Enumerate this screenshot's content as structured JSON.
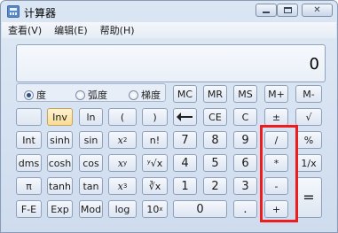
{
  "window": {
    "title": "计算器",
    "close_glyph": "✕"
  },
  "menu": [
    "查看(V)",
    "编辑(E)",
    "帮助(H)"
  ],
  "display": {
    "value": "0"
  },
  "angle_modes": [
    {
      "label": "度",
      "checked": true
    },
    {
      "label": "弧度",
      "checked": false
    },
    {
      "label": "梯度",
      "checked": false
    }
  ],
  "keys": {
    "mc": "MC",
    "mr": "MR",
    "ms": "MS",
    "mplus": "M+",
    "mminus": "M-",
    "inv": "Inv",
    "ln": "ln",
    "lparen": "(",
    "rparen": ")",
    "ce": "CE",
    "c": "C",
    "plusminus": "±",
    "sqrt": "√",
    "int": "Int",
    "sinh": "sinh",
    "sin": "sin",
    "x2_base": "x",
    "x2_exp": "2",
    "factorial": "n!",
    "seven": "7",
    "eight": "8",
    "nine": "9",
    "divide": "/",
    "percent": "%",
    "dms": "dms",
    "cosh": "cosh",
    "cos": "cos",
    "xy_base": "x",
    "xy_exp": "y",
    "yroot": "ʸ√x",
    "four": "4",
    "five": "5",
    "six": "6",
    "multiply": "*",
    "reciprocal": "1/x",
    "pi": "π",
    "tanh": "tanh",
    "tan": "tan",
    "x3_base": "x",
    "x3_exp": "3",
    "cuberoot": "∛x",
    "one": "1",
    "two": "2",
    "three": "3",
    "subtract": "-",
    "equals": "=",
    "fe": "F-E",
    "exp": "Exp",
    "mod": "Mod",
    "log": "log",
    "tenx_base": "10",
    "tenx_exp": "x",
    "zero": "0",
    "decimal": ".",
    "add": "+"
  }
}
